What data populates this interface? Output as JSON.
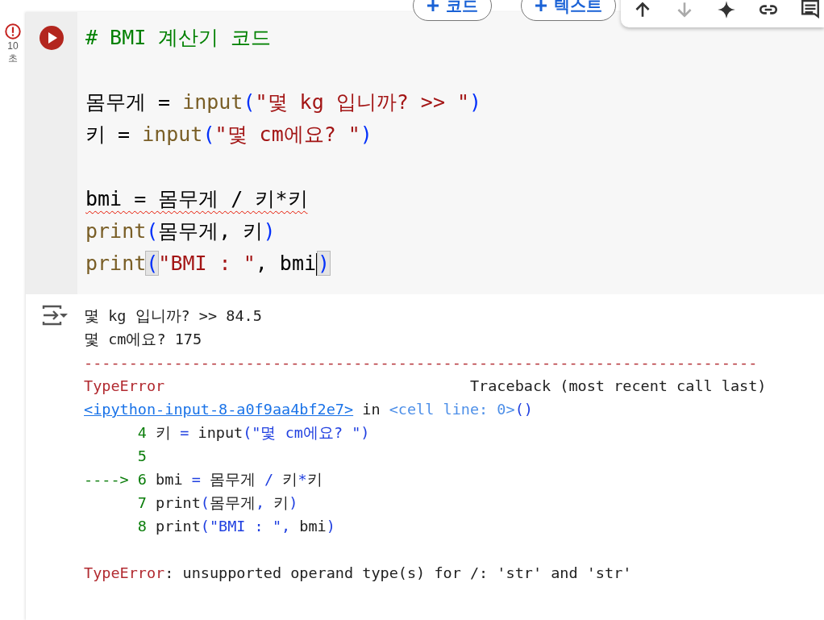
{
  "gutter": {
    "error": true,
    "duration": "10",
    "duration_unit": "초"
  },
  "cell_toolbar": {
    "buttons": [
      {
        "label": "코드"
      },
      {
        "label": "텍스트"
      }
    ],
    "icons": [
      {
        "kind": "up",
        "disabled": false
      },
      {
        "kind": "down",
        "disabled": true
      },
      {
        "kind": "sparkle",
        "disabled": false
      },
      {
        "kind": "link",
        "disabled": false
      },
      {
        "kind": "comment",
        "disabled": false
      }
    ]
  },
  "code_lines": [
    {
      "kind": "code",
      "tokens": [
        {
          "kind": "comment",
          "text": "# BMI 계산기 코드"
        }
      ]
    },
    {
      "kind": "blank"
    },
    {
      "kind": "code",
      "tokens": [
        {
          "kind": "plain",
          "text": "몸무게 = "
        },
        {
          "kind": "builtin",
          "text": "input"
        },
        {
          "kind": "paren",
          "text": "("
        },
        {
          "kind": "string",
          "text": "\"몇 kg 입니까? >> \""
        },
        {
          "kind": "paren",
          "text": ")"
        }
      ]
    },
    {
      "kind": "code",
      "tokens": [
        {
          "kind": "plain",
          "text": "키 = "
        },
        {
          "kind": "builtin",
          "text": "input"
        },
        {
          "kind": "paren",
          "text": "("
        },
        {
          "kind": "string",
          "text": "\"몇 cm에요? \""
        },
        {
          "kind": "paren",
          "text": ")"
        }
      ]
    },
    {
      "kind": "blank"
    },
    {
      "kind": "code",
      "squiggle": true,
      "tokens": [
        {
          "kind": "plain",
          "text": "bmi = 몸무게 / 키*키"
        }
      ]
    },
    {
      "kind": "code",
      "tokens": [
        {
          "kind": "builtin",
          "text": "print"
        },
        {
          "kind": "paren",
          "text": "("
        },
        {
          "kind": "plain",
          "text": "몸무게, 키"
        },
        {
          "kind": "paren",
          "text": ")"
        }
      ]
    },
    {
      "kind": "code",
      "cursor": true,
      "tokens": [
        {
          "kind": "builtin",
          "text": "print"
        },
        {
          "kind": "paren_match",
          "text": "("
        },
        {
          "kind": "string",
          "text": "\"BMI : \""
        },
        {
          "kind": "plain",
          "text": ", bmi"
        },
        {
          "kind": "paren_match",
          "text": ")"
        }
      ]
    }
  ],
  "output_lines": [
    {
      "kind": "text",
      "tokens": [
        {
          "kind": "out",
          "text": "몇 kg 입니까? >> 84.5"
        }
      ]
    },
    {
      "kind": "text",
      "tokens": [
        {
          "kind": "out",
          "text": "몇 cm에요? 175"
        }
      ]
    },
    {
      "kind": "text",
      "tokens": [
        {
          "kind": "err",
          "text": "---------------------------------------------------------------------------"
        }
      ]
    },
    {
      "kind": "text",
      "tokens": [
        {
          "kind": "err",
          "text": "TypeError"
        },
        {
          "kind": "out",
          "text": "                                  Traceback (most recent call last)"
        }
      ]
    },
    {
      "kind": "text",
      "tokens": [
        {
          "kind": "link",
          "text": "<ipython-input-8-a0f9aa4bf2e7>"
        },
        {
          "kind": "out",
          "text": " in "
        },
        {
          "kind": "cellref",
          "text": "<cell line: 0>"
        },
        {
          "kind": "blue",
          "text": "()"
        }
      ]
    },
    {
      "kind": "text",
      "tokens": [
        {
          "kind": "lineno",
          "text": "      4"
        },
        {
          "kind": "out",
          "text": " 키 "
        },
        {
          "kind": "blue",
          "text": "="
        },
        {
          "kind": "out",
          "text": " input"
        },
        {
          "kind": "blue",
          "text": "(\"몇 cm에요? \")"
        }
      ]
    },
    {
      "kind": "text",
      "tokens": [
        {
          "kind": "lineno",
          "text": "      5"
        }
      ]
    },
    {
      "kind": "text",
      "tokens": [
        {
          "kind": "lineno",
          "text": "----> 6"
        },
        {
          "kind": "out",
          "text": " bmi "
        },
        {
          "kind": "blue",
          "text": "="
        },
        {
          "kind": "out",
          "text": " 몸무게 "
        },
        {
          "kind": "blue",
          "text": "/"
        },
        {
          "kind": "out",
          "text": " 키"
        },
        {
          "kind": "blue",
          "text": "*"
        },
        {
          "kind": "out",
          "text": "키"
        }
      ]
    },
    {
      "kind": "text",
      "tokens": [
        {
          "kind": "lineno",
          "text": "      7"
        },
        {
          "kind": "out",
          "text": " print"
        },
        {
          "kind": "blue",
          "text": "("
        },
        {
          "kind": "out",
          "text": "몸무게"
        },
        {
          "kind": "blue",
          "text": ","
        },
        {
          "kind": "out",
          "text": " 키"
        },
        {
          "kind": "blue",
          "text": ")"
        }
      ]
    },
    {
      "kind": "text",
      "tokens": [
        {
          "kind": "lineno",
          "text": "      8"
        },
        {
          "kind": "out",
          "text": " print"
        },
        {
          "kind": "blue",
          "text": "(\"BMI : \","
        },
        {
          "kind": "out",
          "text": " bmi"
        },
        {
          "kind": "blue",
          "text": ")"
        }
      ]
    },
    {
      "kind": "blank"
    },
    {
      "kind": "text",
      "tokens": [
        {
          "kind": "err",
          "text": "TypeError"
        },
        {
          "kind": "out",
          "text": ": unsupported operand type(s) for /: 'str' and 'str'"
        }
      ]
    }
  ]
}
